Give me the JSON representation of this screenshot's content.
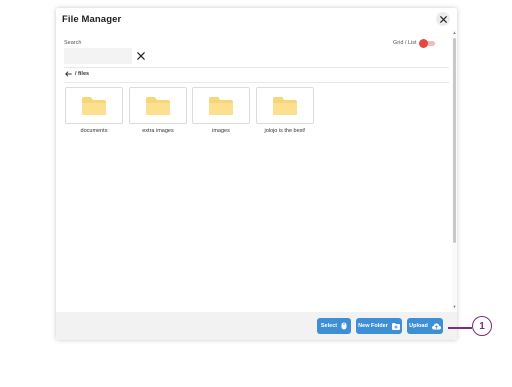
{
  "dialog": {
    "title": "File Manager"
  },
  "search": {
    "label": "Search",
    "value": "",
    "placeholder": ""
  },
  "view_toggle": {
    "label": "Grid / List",
    "state": "on",
    "accent_color": "#e5473e"
  },
  "breadcrumb": {
    "path": "/ files"
  },
  "folders": [
    {
      "name": "documents",
      "icon": "folder-icon"
    },
    {
      "name": "extra images",
      "icon": "folder-icon"
    },
    {
      "name": "images",
      "icon": "folder-icon"
    },
    {
      "name": "jolojo is the best!",
      "icon": "folder-icon"
    }
  ],
  "footer": {
    "select_label": "Select",
    "new_folder_label": "New Folder",
    "upload_label": "Upload",
    "button_color": "#3e8fd6"
  },
  "callout": {
    "number": "1",
    "color": "#7b2d7f"
  }
}
